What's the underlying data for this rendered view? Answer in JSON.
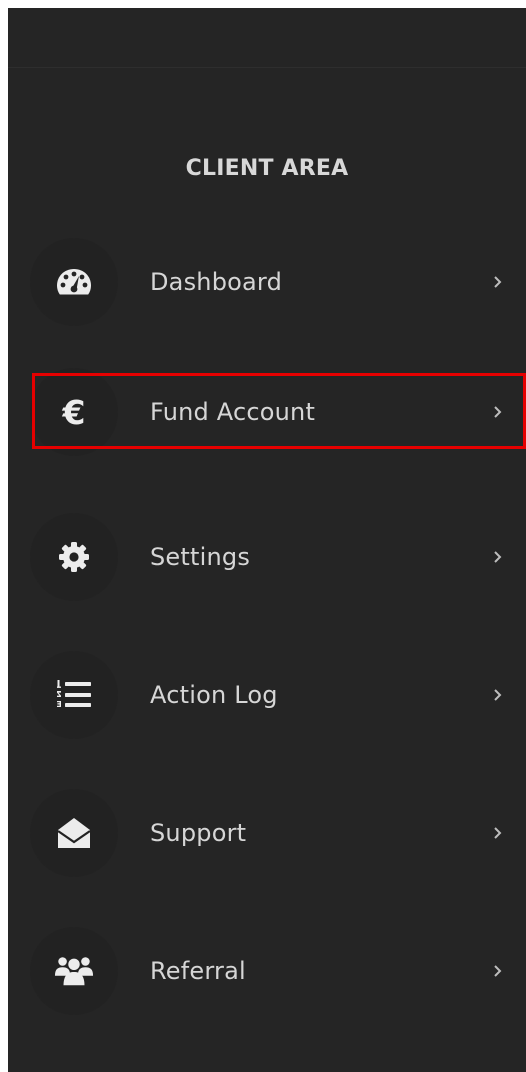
{
  "sidebar": {
    "section_title": "CLIENT AREA",
    "items": [
      {
        "label": "Dashboard",
        "icon": "dashboard-gauge-icon"
      },
      {
        "label": "Fund Account",
        "icon": "euro-icon",
        "highlighted": true
      },
      {
        "label": "Settings",
        "icon": "gear-icon"
      },
      {
        "label": "Action Log",
        "icon": "numbered-list-icon"
      },
      {
        "label": "Support",
        "icon": "envelope-open-icon"
      },
      {
        "label": "Referral",
        "icon": "users-group-icon"
      }
    ]
  },
  "colors": {
    "sidebar_bg": "#252525",
    "icon_circle_bg": "#222222",
    "text": "#d6d6d6",
    "highlight": "#e60000"
  }
}
